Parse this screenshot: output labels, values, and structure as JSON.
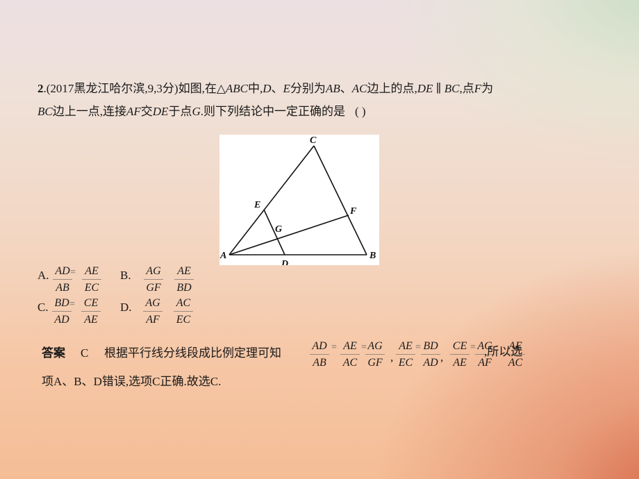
{
  "question": {
    "number": "2",
    "line1_prefix": ".(2017黑龙江哈尔滨,9,3分)如图,在△",
    "line1_abc": "ABC",
    "line1_mid1": "中,",
    "line1_d": "D",
    "line1_sep": "、",
    "line1_e": "E",
    "line1_mid2": "分别为",
    "line1_ab": "AB",
    "line1_sep2": "、",
    "line1_ac": "AC",
    "line1_mid3": "边上的点,",
    "line1_de": "DE",
    "line1_parallel": " ∥ ",
    "line1_bc": "BC",
    "line1_mid4": ",点",
    "line1_f": "F",
    "line1_end": "为",
    "line2_bc": "BC",
    "line2_mid1": "边上一点,连接",
    "line2_af": "AF",
    "line2_mid2": "交",
    "line2_de": "DE",
    "line2_mid3": "于点",
    "line2_g": "G",
    "line2_end": ".则下列结论中一定正确的是",
    "blank": "(        )"
  },
  "figure": {
    "points": {
      "A": "A",
      "B": "B",
      "C": "C",
      "D": "D",
      "E": "E",
      "F": "F",
      "G": "G"
    },
    "segments": [
      "AB",
      "BC",
      "CA",
      "DE",
      "AF"
    ]
  },
  "options": [
    {
      "label": "A.",
      "left": {
        "num": "AD",
        "den": "AB"
      },
      "right": {
        "num": "AE",
        "den": "EC"
      }
    },
    {
      "label": "B.",
      "left": {
        "num": "AG",
        "den": "GF"
      },
      "right": {
        "num": "AE",
        "den": "BD"
      }
    },
    {
      "label": "C.",
      "left": {
        "num": "BD",
        "den": "AD"
      },
      "right": {
        "num": "CE",
        "den": "AE"
      }
    },
    {
      "label": "D.",
      "left": {
        "num": "AG",
        "den": "AF"
      },
      "right": {
        "num": "AC",
        "den": "EC"
      }
    }
  ],
  "answer": {
    "heading": "答案",
    "choice": "C",
    "text1": "根据平行线分线段成比例定理可知",
    "fractions": [
      {
        "num": "AD",
        "den": "AB"
      },
      {
        "num": "AE",
        "den": "AC"
      },
      {
        "num": "AG",
        "den": "GF"
      },
      {
        "num": "AE",
        "den": "EC"
      },
      {
        "num": "BD",
        "den": "AD"
      },
      {
        "num": "CE",
        "den": "AE"
      },
      {
        "num": "AG",
        "den": "AF"
      },
      {
        "num": "AE",
        "den": "AC"
      }
    ],
    "eq": "=",
    "comma": ",",
    "text2": ",所以选",
    "line2": "项A、B、D错误,选项C正确.故选C."
  }
}
